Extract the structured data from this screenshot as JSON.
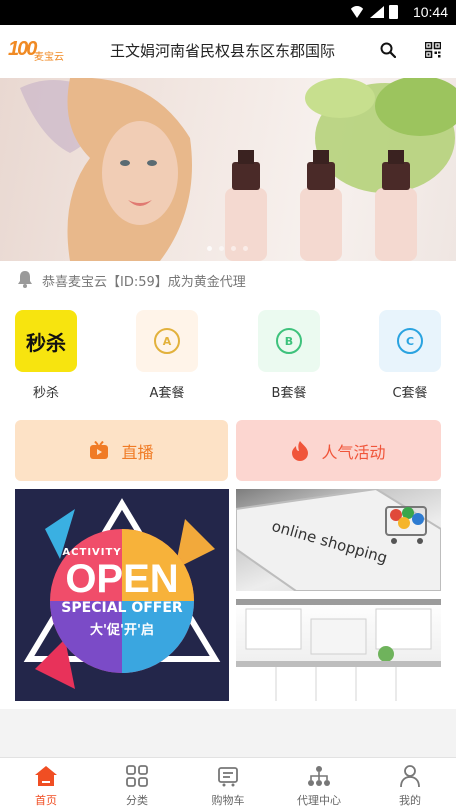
{
  "status_bar": {
    "time": "10:44"
  },
  "header": {
    "logo_number": "100",
    "logo_text": "麦宝云",
    "title": "王文娟河南省民权县东区东郡国际"
  },
  "notice": {
    "text": "恭喜麦宝云【ID:59】成为黄金代理"
  },
  "quick_menu": [
    {
      "label": "秒杀",
      "icon": "flash-sale-icon",
      "badge_text": "秒杀"
    },
    {
      "label": "A套餐",
      "icon": "package-a-icon",
      "badge_text": "A",
      "color": "#e2b13c",
      "bg": "#fff4e9"
    },
    {
      "label": "B套餐",
      "icon": "package-b-icon",
      "badge_text": "B",
      "color": "#3ec27c",
      "bg": "#ebfaf0"
    },
    {
      "label": "C套餐",
      "icon": "package-c-icon",
      "badge_text": "C",
      "color": "#2aa3e0",
      "bg": "#e8f4fc"
    }
  ],
  "promo": {
    "live_label": "直播",
    "hot_label": "人气活动",
    "open_tile": {
      "line1": "ACTIVITY",
      "line2": "OPEN",
      "line3": "SPECIAL OFFER",
      "line4": "大'促'开'启"
    },
    "shop_tile": {
      "text": "online shopping"
    }
  },
  "tabs": [
    {
      "label": "首页",
      "icon": "home-icon",
      "active": true
    },
    {
      "label": "分类",
      "icon": "category-icon",
      "active": false
    },
    {
      "label": "购物车",
      "icon": "cart-icon",
      "active": false
    },
    {
      "label": "代理中心",
      "icon": "agent-center-icon",
      "active": false
    },
    {
      "label": "我的",
      "icon": "profile-icon",
      "active": false
    }
  ],
  "colors": {
    "accent": "#f04e23",
    "live": "#f07b25",
    "hot": "#f0553a"
  }
}
